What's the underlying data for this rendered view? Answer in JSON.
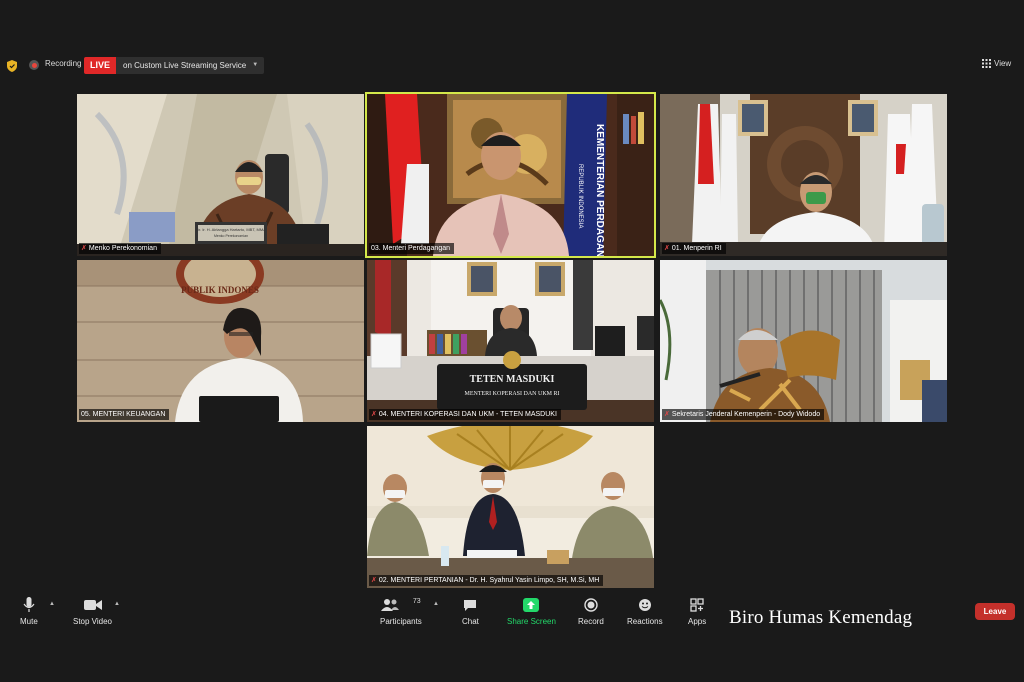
{
  "topbar": {
    "recording_label": "Recording",
    "live_badge": "LIVE",
    "live_service": "on Custom Live Streaming Service",
    "view_label": "View"
  },
  "tiles": [
    {
      "name": "Menko Perekonomian",
      "nameplate": "Dr. Ir. H. Airlangga Hartarto, MBT, MMA",
      "nameplate_sub": "Menko Perekonomian"
    },
    {
      "name": "03. Menteri Perdagangan",
      "banner_text": "KEMENTERIAN PERDAGANGAN",
      "banner_sub": "REPUBLIK INDONESIA"
    },
    {
      "name": "01. Menperin RI"
    },
    {
      "name": "05. MENTERI KEUANGAN",
      "wall_text": "PUBLIK INDONES"
    },
    {
      "name": "04. MENTERI KOPERASI DAN UKM - TETEN MASDUKI",
      "desk_title": "TETEN MASDUKI",
      "desk_sub": "MENTERI KOPERASI DAN UKM RI"
    },
    {
      "name": "Sekretaris Jenderal Kemenperin - Dody Widodo"
    },
    {
      "name": "02. MENTERI PERTANIAN - Dr. H. Syahrul Yasin Limpo, SH, M.Si, MH"
    }
  ],
  "toolbar": {
    "mute": "Mute",
    "stop_video": "Stop Video",
    "participants": "Participants",
    "participants_count": "73",
    "chat": "Chat",
    "share_screen": "Share Screen",
    "record": "Record",
    "reactions": "Reactions",
    "apps": "Apps",
    "leave": "Leave"
  },
  "watermark": "Biro Humas Kemendag",
  "colors": {
    "background": "#1a1a1a",
    "live_red": "#e02828",
    "active_speaker": "#d4e84a",
    "share_green": "#23d96a",
    "leave_red": "#c4302b"
  }
}
